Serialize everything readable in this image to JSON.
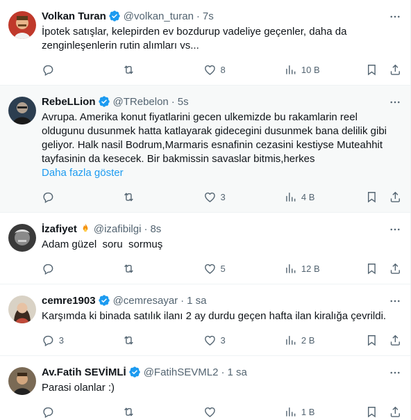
{
  "accent_color": "#1d9bf0",
  "verified_color": "#1d9bf0",
  "tweets": [
    {
      "name": "Volkan Turan",
      "handle": "@volkan_turan",
      "time": "7s",
      "verified": true,
      "text": "İpotek satışlar, kelepirden ev bozdurup vadeliye geçenler, daha da zenginleşenlerin rutin alımları vs...",
      "show_more": "",
      "replies": "",
      "retweets": "",
      "likes": "8",
      "views": "10 B",
      "avatar_icon": "avatar-photo"
    },
    {
      "name": "RebeLLion",
      "handle": "@TRebelon",
      "time": "5s",
      "verified": true,
      "text": "Avrupa. Amerika konut fiyatlarini gecen ulkemizde bu rakamlarin reel oldugunu dusunmek hatta katlayarak gidecegini dusunmek bana delilik gibi geliyor. Halk nasil Bodrum,Marmaris esnafinin cezasini kestiyse Muteahhit tayfasinin da kesecek. Bir bakmissin savaslar bitmis,herkes",
      "show_more": "Daha fazla göster",
      "replies": "",
      "retweets": "",
      "likes": "3",
      "views": "4 B",
      "avatar_icon": "avatar-photo"
    },
    {
      "name": "İzafiyet",
      "handle": "@izafibilgi",
      "time": "8s",
      "verified": false,
      "text": "Adam güzel  soru  sormuş",
      "show_more": "",
      "replies": "",
      "retweets": "",
      "likes": "5",
      "views": "12 B",
      "avatar_icon": "avatar-photo"
    },
    {
      "name": "cemre1903",
      "handle": "@cemresayar",
      "time": "1 sa",
      "verified": true,
      "text": "Karşımda ki binada satılık ilanı 2 ay durdu geçen hafta ilan kiralığa çevrildi.",
      "show_more": "",
      "replies": "3",
      "retweets": "",
      "likes": "3",
      "views": "2 B",
      "avatar_icon": "avatar-photo"
    },
    {
      "name": "Av.Fatih SEVİMLİ",
      "handle": "@FatihSEVML2",
      "time": "1 sa",
      "verified": true,
      "text": "Parasi olanlar :)",
      "show_more": "",
      "replies": "",
      "retweets": "",
      "likes": "",
      "views": "1 B",
      "avatar_icon": "avatar-photo"
    }
  ]
}
